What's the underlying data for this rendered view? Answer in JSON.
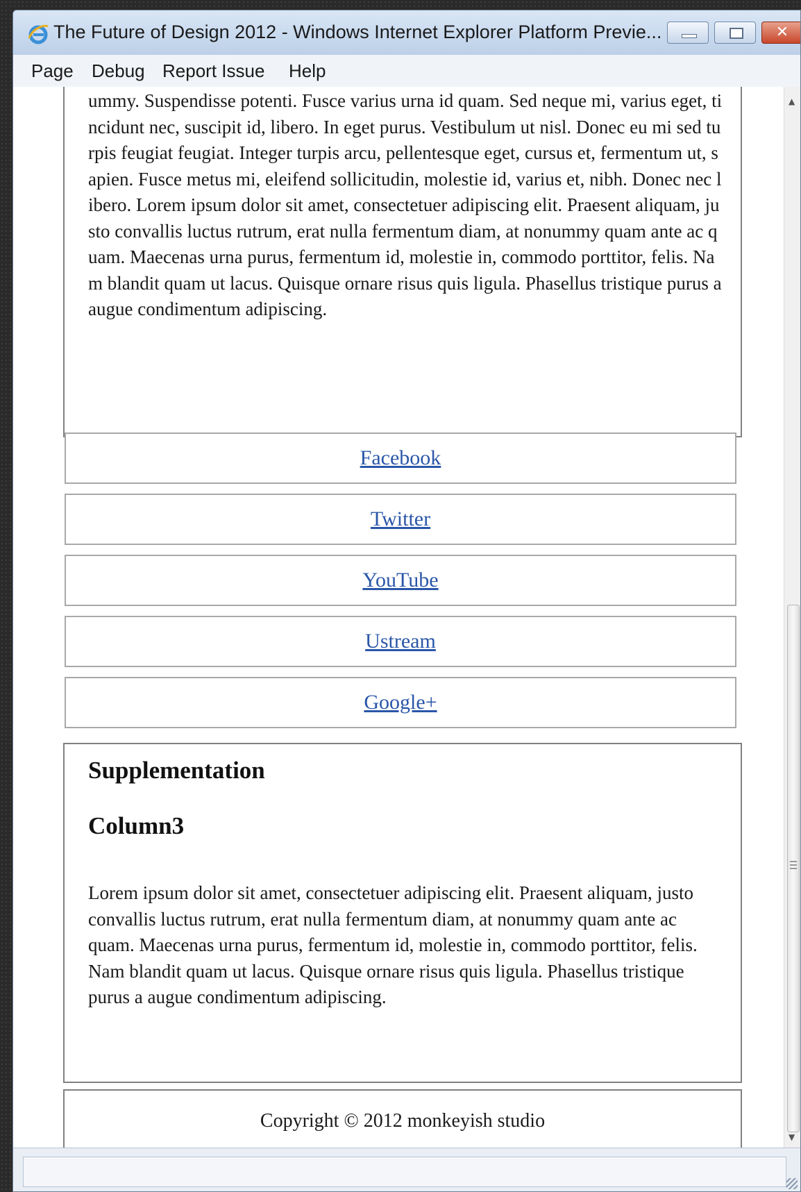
{
  "window": {
    "title": "The Future of Design 2012 - Windows Internet Explorer Platform Previe...",
    "close_glyph": "✕"
  },
  "menu": {
    "items": [
      "Page",
      "Debug",
      "Report Issue",
      "Help"
    ]
  },
  "article": {
    "text": "ummy. Suspendisse potenti. Fusce varius urna id quam. Sed neque mi, varius eget, tincidunt nec, suscipit id, libero. In eget purus. Vestibulum ut nisl. Donec eu mi sed turpis feugiat feugiat. Integer turpis arcu, pellentesque eget, cursus et, fermentum ut, sapien. Fusce metus mi, eleifend sollicitudin, molestie id, varius et, nibh. Donec nec libero. Lorem ipsum dolor sit amet, consectetuer adipiscing elit. Praesent aliquam, justo convallis luctus rutrum, erat nulla fermentum diam, at nonummy quam ante ac quam. Maecenas urna purus, fermentum id, molestie in, commodo porttitor, felis. Nam blandit quam ut lacus. Quisque ornare risus quis ligula. Phasellus tristique purus a augue condimentum adipiscing."
  },
  "social_links": [
    "Facebook",
    "Twitter",
    "YouTube",
    "Ustream",
    "Google+"
  ],
  "supplementation": {
    "heading": "Supplementation",
    "subheading": "Column3",
    "text": "Lorem ipsum dolor sit amet, consectetuer adipiscing elit. Praesent aliquam, justo convallis luctus rutrum, erat nulla fermentum diam, at nonummy quam ante ac quam. Maecenas urna purus, fermentum id, molestie in, commodo porttitor, felis. Nam blandit quam ut lacus. Quisque ornare risus quis ligula. Phasellus tristique purus a augue condimentum adipiscing."
  },
  "footer": {
    "copyright": "Copyright © 2012 monkeyish studio"
  },
  "colors": {
    "link": "#2a56a8",
    "titlebar": "#c9d9ec",
    "close_button": "#c8462c"
  },
  "icons": {
    "browser": "ie-logo-icon",
    "minimize": "minimize-icon",
    "maximize": "maximize-icon",
    "close": "close-icon",
    "scroll_up": "chevron-up-icon",
    "scroll_down": "chevron-down-icon",
    "resize": "resize-grip-icon"
  }
}
